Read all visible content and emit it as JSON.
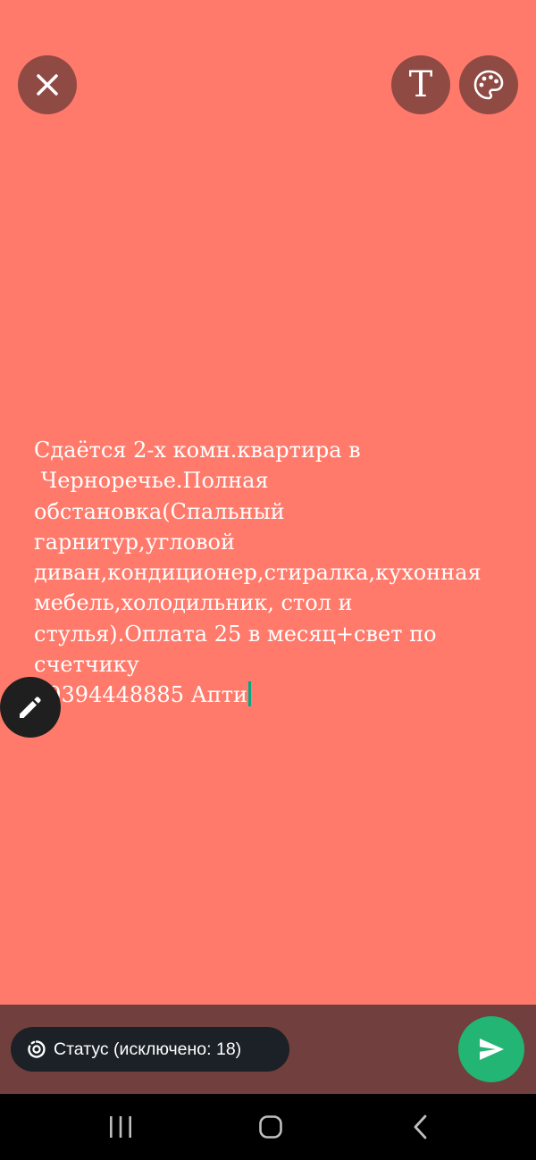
{
  "editor": {
    "background_color": "#ff7a6b",
    "text": "Сдаётся 2-х комн.квартира в\n Черноречье.Полная\nобстановка(Спальный\nгарнитур,угловой\nдиван,кондиционер,стиралка,кухонная\nмебель,холодильник, стол и\nстулья).Оплата 25 в месяц+свет по\nсчетчику\n89394448885 Апти"
  },
  "toolbar": {
    "close_icon": "close-icon",
    "text_style_label": "T",
    "palette_icon": "palette-icon"
  },
  "compose": {
    "status_label": "Статус (исключено: 18)",
    "send_icon": "send-icon",
    "accent_color": "#22b573"
  },
  "navigation": {
    "recent_icon": "recent-apps-icon",
    "home_icon": "home-icon",
    "back_icon": "back-icon"
  }
}
